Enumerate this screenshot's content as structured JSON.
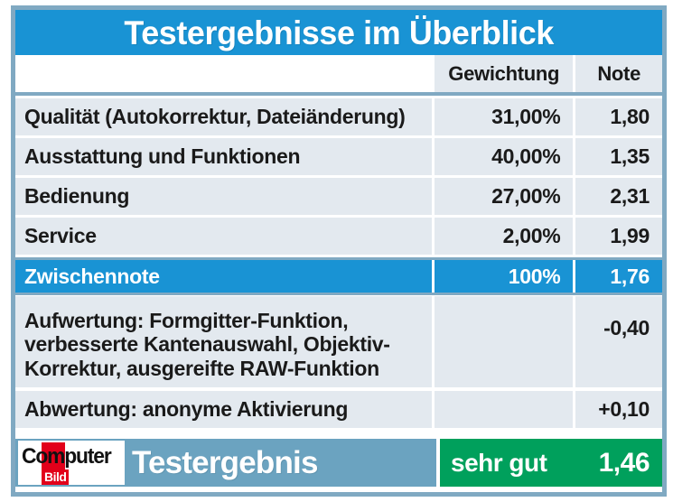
{
  "title": "Testergebnisse im Überblick",
  "colors": {
    "header_blue": "#1993d4",
    "cell_bg": "#e3e9ef",
    "frame_border": "#80a9c2",
    "result_bar": "#6ba3c0",
    "verdict_green": "#00a05c",
    "logo_red": "#e2001a"
  },
  "table": {
    "columns": [
      "",
      "Gewichtung",
      "Note"
    ],
    "rows": [
      {
        "label": "Qualität (Autokorrektur, Dateiänderung)",
        "weight": "31,00%",
        "grade": "1,80"
      },
      {
        "label": "Ausstattung und Funktionen",
        "weight": "40,00%",
        "grade": "1,35"
      },
      {
        "label": "Bedienung",
        "weight": "27,00%",
        "grade": "2,31"
      },
      {
        "label": "Service",
        "weight": "2,00%",
        "grade": "1,99"
      }
    ],
    "subtotal": {
      "label": "Zwischennote",
      "weight": "100%",
      "grade": "1,76"
    },
    "upgrade": {
      "lines": [
        "Aufwertung: Formgitter-Funktion,",
        "verbesserte Kantenauswahl, Objektiv-",
        "Korrektur, ausgereifte RAW-Funktion"
      ],
      "weight": "",
      "grade": "-0,40"
    },
    "downgrade": {
      "label": "Abwertung: anonyme Aktivierung",
      "weight": "",
      "grade": "+0,10"
    }
  },
  "result": {
    "logo": {
      "word_top": "Computer",
      "word_bottom": "Bild"
    },
    "label": "Testergebnis",
    "verdict": "sehr gut",
    "grade": "1,46"
  }
}
